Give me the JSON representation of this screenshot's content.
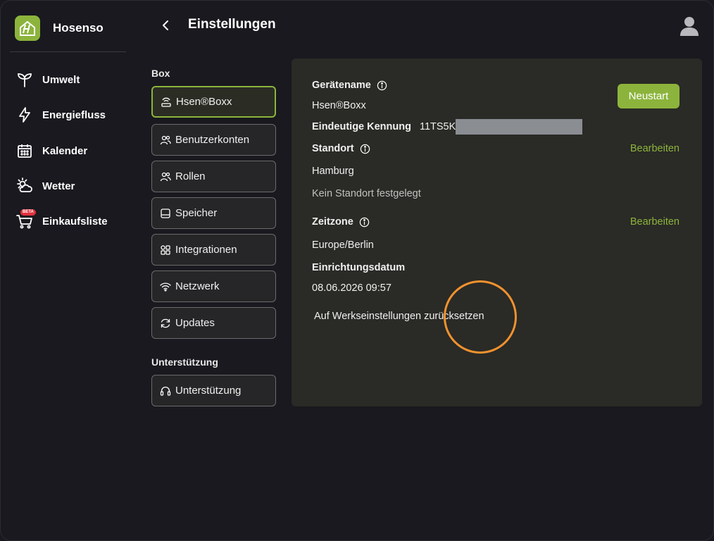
{
  "brand": {
    "name": "Hosenso",
    "logo_letter": "H"
  },
  "sidebar": {
    "items": [
      {
        "label": "Umwelt",
        "icon": "sprout-icon"
      },
      {
        "label": "Energiefluss",
        "icon": "lightning-icon"
      },
      {
        "label": "Kalender",
        "icon": "calendar-icon"
      },
      {
        "label": "Wetter",
        "icon": "weather-icon"
      },
      {
        "label": "Einkaufsliste",
        "icon": "cart-icon",
        "badge": "BETA"
      }
    ]
  },
  "header": {
    "title": "Einstellungen"
  },
  "settings_menu": {
    "box_label": "Box",
    "box_items": [
      {
        "label": "Hsen®Boxx",
        "icon": "router-icon",
        "active": true
      },
      {
        "label": "Benutzerkonten",
        "icon": "users-icon"
      },
      {
        "label": "Rollen",
        "icon": "users-icon"
      },
      {
        "label": "Speicher",
        "icon": "storage-icon"
      },
      {
        "label": "Integrationen",
        "icon": "apps-icon"
      },
      {
        "label": "Netzwerk",
        "icon": "wifi-icon"
      },
      {
        "label": "Updates",
        "icon": "refresh-icon"
      }
    ],
    "support_label": "Unterstützung",
    "support_items": [
      {
        "label": "Unterstützung",
        "icon": "headset-icon"
      }
    ]
  },
  "device": {
    "name_label": "Gerätename",
    "name_value": "Hsen®Boxx",
    "id_label": "Eindeutige Kennung",
    "id_value": "11TS5K",
    "restart_label": "Neustart",
    "location_label": "Standort",
    "location_edit": "Bearbeiten",
    "location_value": "Hamburg",
    "location_note": "Kein Standort festgelegt",
    "timezone_label": "Zeitzone",
    "timezone_edit": "Bearbeiten",
    "timezone_value": "Europe/Berlin",
    "setup_date_label": "Einrichtungsdatum",
    "setup_date_value": "08.06.2026 09:57",
    "factory_reset_label": "Auf Werkseinstellungen zurücksetzen"
  },
  "colors": {
    "accent": "#8cb43c",
    "panel": "#2a2a26",
    "background": "#19191f",
    "cursor_ring": "#f0922e",
    "beta_badge": "#e0303c"
  }
}
